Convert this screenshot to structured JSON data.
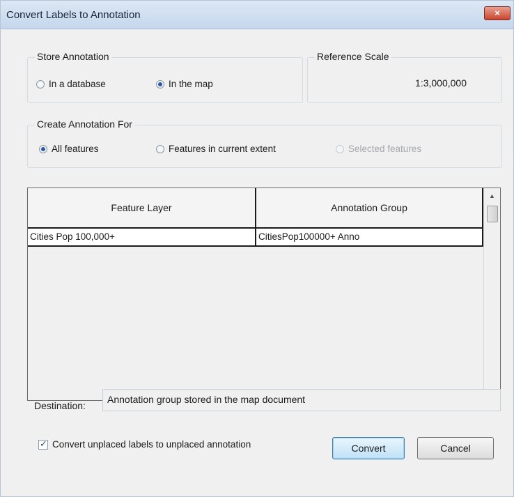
{
  "window": {
    "title": "Convert Labels to Annotation",
    "close_label": "×"
  },
  "store_annotation": {
    "title": "Store Annotation",
    "options": [
      {
        "label": "In a database",
        "selected": false
      },
      {
        "label": "In the map",
        "selected": true
      }
    ]
  },
  "reference_scale": {
    "title": "Reference Scale",
    "value": "1:3,000,000"
  },
  "create_annotation_for": {
    "title": "Create Annotation For",
    "options": [
      {
        "label": "All features",
        "selected": true,
        "enabled": true
      },
      {
        "label": "Features in current extent",
        "selected": false,
        "enabled": true
      },
      {
        "label": "Selected features",
        "selected": false,
        "enabled": false
      }
    ]
  },
  "grid": {
    "columns": [
      "Feature Layer",
      "Annotation Group"
    ],
    "rows": [
      [
        "Cities Pop 100,000+",
        "CitiesPop100000+ Anno"
      ]
    ],
    "scroll_up_icon": "▲",
    "scroll_down_icon": "▼"
  },
  "destination": {
    "label": "Destination:",
    "value": "Annotation group stored in the map document"
  },
  "footer": {
    "checkbox_label": "Convert unplaced labels to unplaced annotation",
    "checkbox_checked": true,
    "checkbox_tick": "✓",
    "convert_label": "Convert",
    "cancel_label": "Cancel"
  },
  "colors": {
    "accent": "#2a5aa8",
    "close_button": "#c9452e",
    "dialog_background": "#f0f0f0"
  }
}
